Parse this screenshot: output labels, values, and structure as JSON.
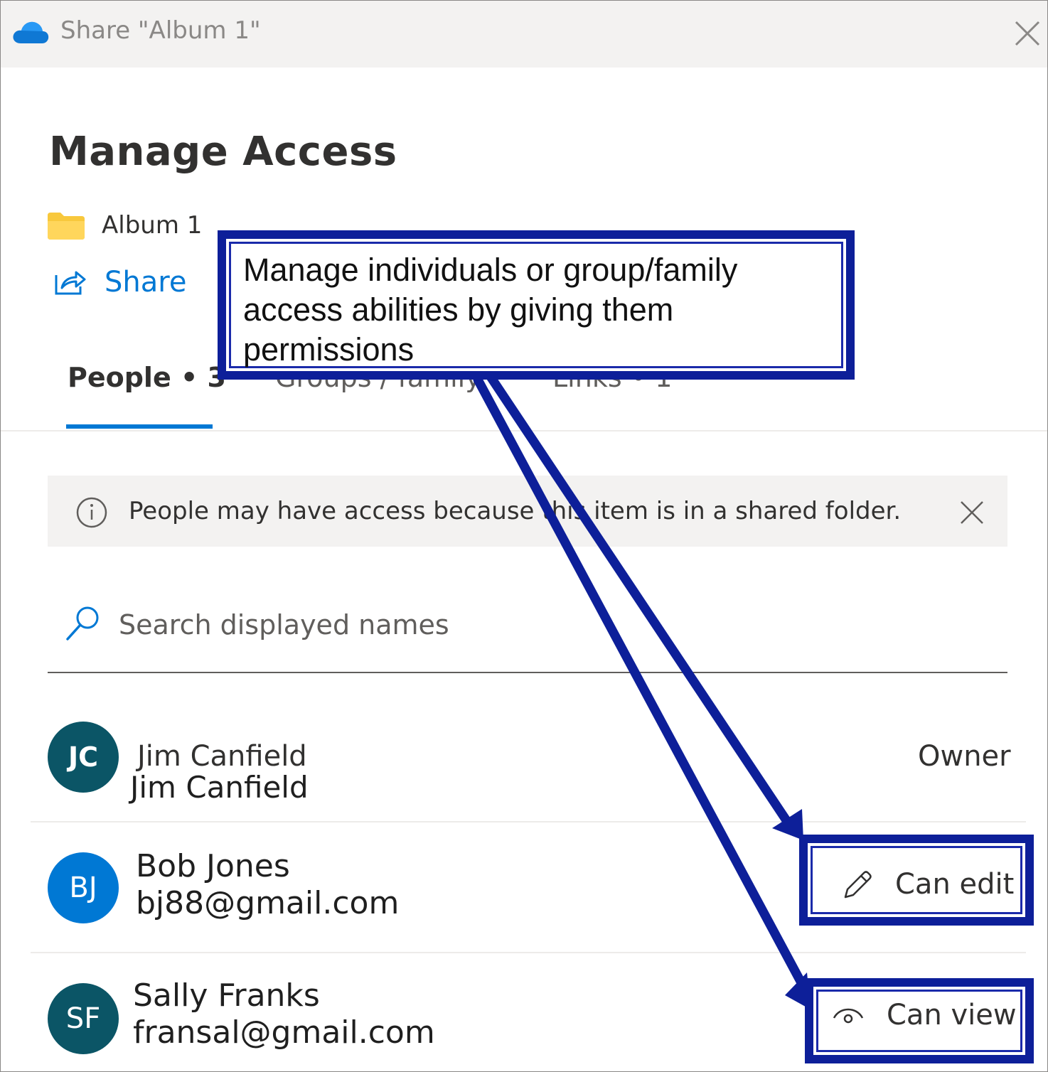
{
  "window": {
    "title": "Share \"Album 1\"",
    "close_icon": "close-icon",
    "app_icon": "onedrive-cloud-icon"
  },
  "panel": {
    "heading": "Manage Access",
    "item_name": "Album 1",
    "share_label": "Share"
  },
  "tabs": [
    {
      "label": "People • 3",
      "selected": true
    },
    {
      "label": "Groups / family",
      "selected": false
    },
    {
      "label": "Links • 1",
      "selected": false
    }
  ],
  "info_bar": {
    "text": "People may have access because this item is in a shared folder."
  },
  "search": {
    "placeholder": "Search displayed names",
    "value": ""
  },
  "people": [
    {
      "initials": "JC",
      "name": "Jim Canfield",
      "detail": "Jim Canfield",
      "permission": "Owner",
      "avatar_color": "#0b5566"
    },
    {
      "initials": "BJ",
      "name": "Bob Jones",
      "detail": "bj88@gmail.com",
      "permission": "Can edit",
      "avatar_color": "#0078d4"
    },
    {
      "initials": "SF",
      "name": "Sally Franks",
      "detail": "fransal@gmail.com",
      "permission": "Can view",
      "avatar_color": "#0b5566"
    }
  ],
  "annotation": {
    "callout_text": "Manage individuals or group/family access abilities by giving them permissions",
    "color": "#0d1f99"
  },
  "colors": {
    "accent": "#0078d4",
    "titlebar": "#f3f2f1",
    "annotation": "#0d1f99"
  }
}
